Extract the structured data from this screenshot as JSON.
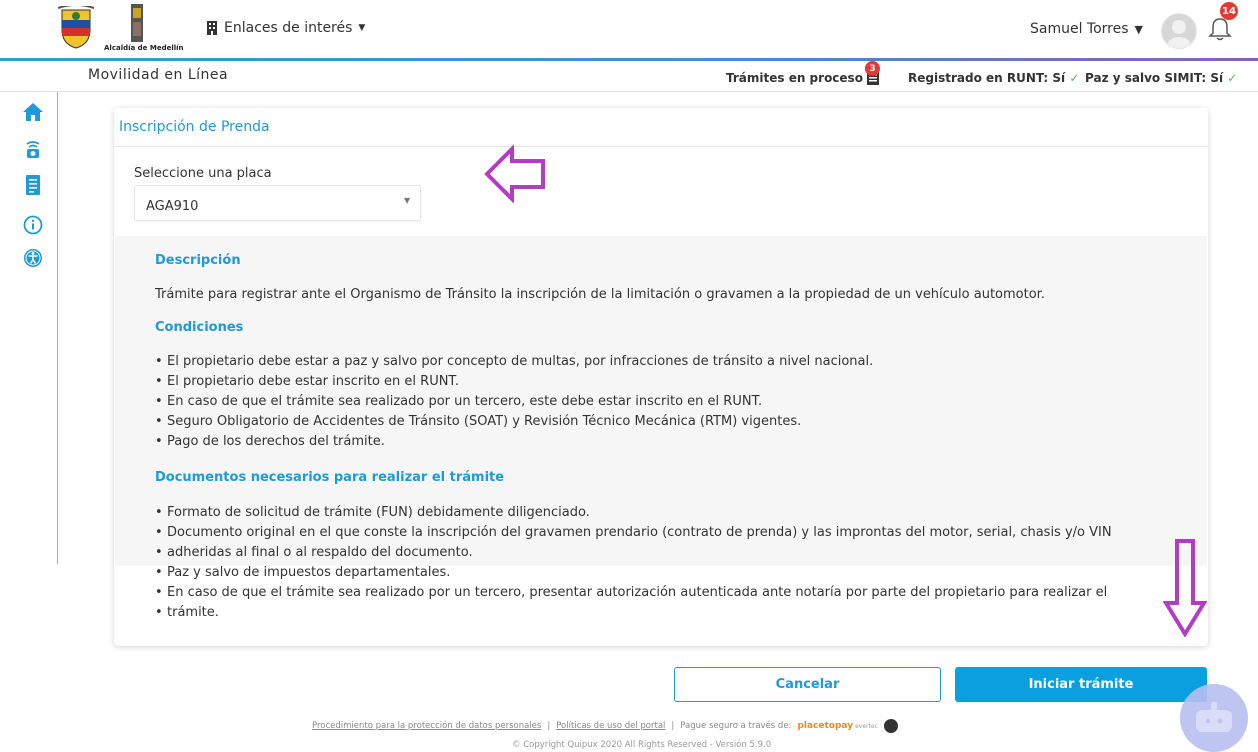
{
  "header": {
    "alcaldia_text": "Alcaldía de Medellín",
    "enlaces_label": "Enlaces de interés",
    "user_name": "Samuel Torres",
    "notifications_count": "14"
  },
  "subheader": {
    "title": "Movilidad en Línea",
    "tramites_label": "Trámites en proceso",
    "tramites_count": "3",
    "runt_label": "Registrado en RUNT: Sí",
    "simit_label": "Paz y salvo SIMIT: Sí",
    "check_mark": "✓"
  },
  "sidebar": {
    "items": [
      {
        "icon": "home-icon"
      },
      {
        "icon": "traffic-camera-icon"
      },
      {
        "icon": "document-list-icon"
      },
      {
        "icon": "info-icon"
      },
      {
        "icon": "accessibility-icon"
      }
    ]
  },
  "card": {
    "title": "Inscripción de Prenda",
    "select_label": "Seleccione una placa",
    "select_value": "AGA910"
  },
  "info": {
    "descripcion_title": "Descripción",
    "descripcion_text": "Trámite para registrar ante el Organismo de Tránsito la inscripción de la limitación o gravamen a la propiedad de un vehículo automotor.",
    "condiciones_title": "Condiciones",
    "condiciones": [
      "El propietario debe estar a paz y salvo por concepto de multas, por infracciones de tránsito a nivel nacional.",
      "El propietario debe estar inscrito en el RUNT.",
      "En caso de que el trámite sea realizado por un tercero, este debe estar inscrito en el RUNT.",
      "Seguro Obligatorio de Accidentes de Tránsito (SOAT) y Revisión Técnico Mecánica (RTM) vigentes.",
      "Pago de los derechos del trámite."
    ],
    "documentos_title": "Documentos necesarios para realizar el trámite",
    "documentos": [
      "Formato de solicitud de trámite (FUN) debidamente diligenciado.",
      "Documento original en el que conste la inscripción del gravamen prendario (contrato de prenda) y las improntas del motor, serial, chasis y/o VIN",
      "adheridas al final o al respaldo del documento.",
      "Paz y salvo de impuestos departamentales.",
      "En caso de que el trámite sea realizado por un tercero, presentar autorización autenticada ante notaría por parte del propietario para realizar el",
      "trámite."
    ]
  },
  "buttons": {
    "cancel": "Cancelar",
    "start": "Iniciar trámite"
  },
  "footer": {
    "link_privacy": "Procedimiento para la protección de datos personales",
    "link_policies": "Políticas de uso del portal",
    "separator": "|",
    "pay_text": "Pague seguro a través de:",
    "ptp_brand": "placetopay",
    "ptp_sub": "evertec",
    "copyright": "© Copyright Quipux 2020 All Rights Reserved - Versión 5.9.0"
  },
  "colors": {
    "accent_blue": "#1e9ad6",
    "primary_button": "#0a9fdf",
    "annotation_purple": "#b23cc4",
    "badge_red": "#e53935",
    "check_green": "#5cb85c"
  }
}
